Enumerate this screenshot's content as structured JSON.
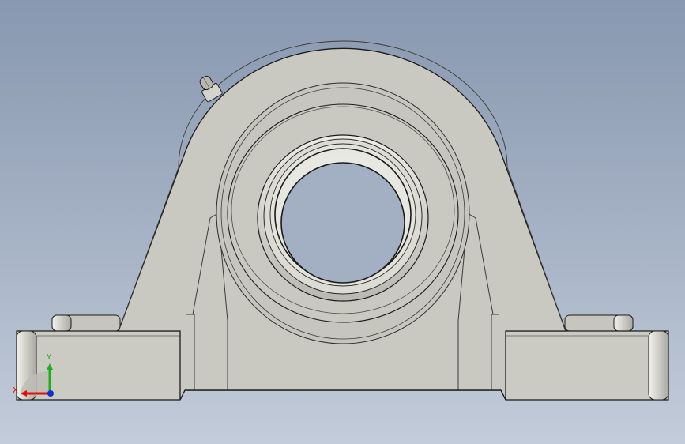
{
  "viewport": {
    "background_top": "#8898b0",
    "background_bottom": "#c3ccda",
    "part_fill": "#c9c9c1",
    "part_edge": "#1b1b1b"
  },
  "model": {
    "type": "pillow-block-bearing",
    "view": "front",
    "components": [
      "housing-base",
      "housing-pedestal",
      "bearing-outer-ring",
      "bearing-inner-ring",
      "bore",
      "grease-nipple",
      "mounting-bolt-left",
      "mounting-bolt-right"
    ]
  },
  "triad": {
    "x_label": "X",
    "y_label": "Y",
    "x_color": "#e01010",
    "y_color": "#18b018",
    "z_color": "#1030d0"
  }
}
